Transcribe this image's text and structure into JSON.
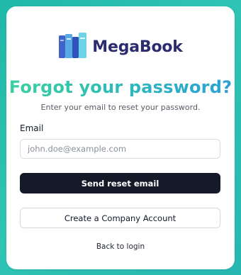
{
  "brand": {
    "name": "MegaBook",
    "icon": "books-logo-icon",
    "color": "#2b2c6e"
  },
  "heading": {
    "title": "Forgot your password?",
    "subtitle": "Enter your email to reset your password."
  },
  "form": {
    "email_label": "Email",
    "email_placeholder": "john.doe@example.com",
    "email_value": ""
  },
  "actions": {
    "send_reset": "Send reset email",
    "create_company": "Create a Company Account",
    "back_to_login": "Back to login"
  },
  "colors": {
    "background_accent": "#2ec4b3",
    "primary_button": "#151a29",
    "title_gradient_start": "#3cd0a0",
    "title_gradient_end": "#2a9fd6"
  }
}
